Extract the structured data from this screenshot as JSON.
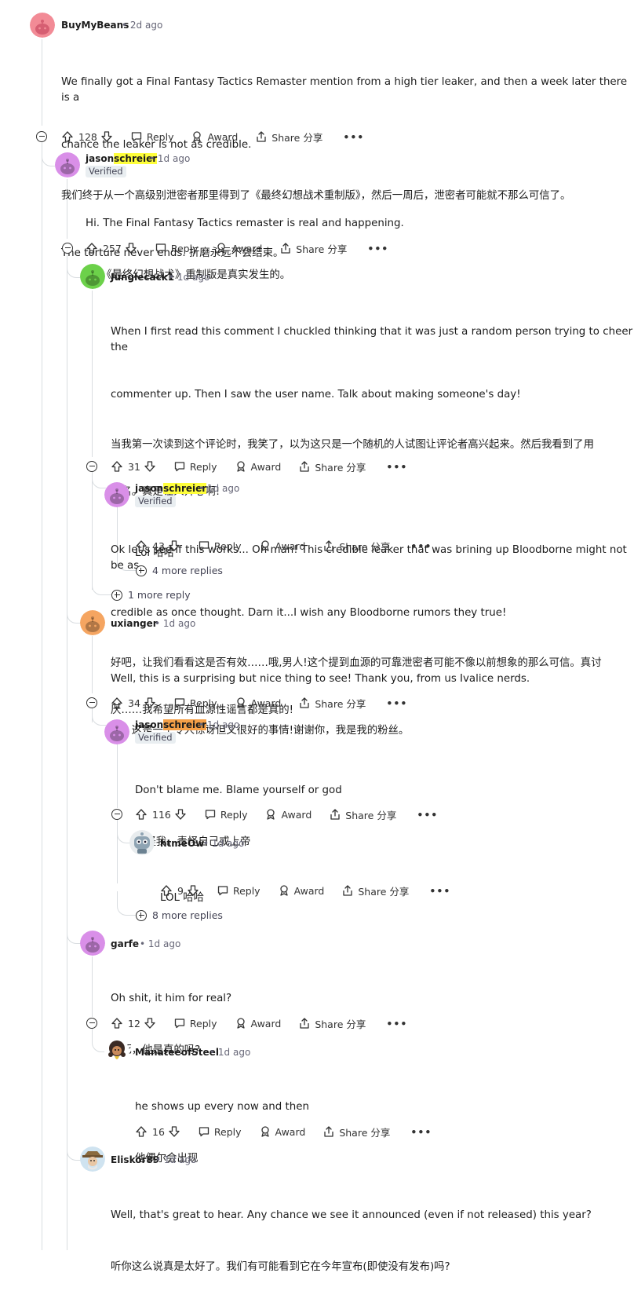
{
  "comments": [
    {
      "id": "c1",
      "user": "BuyMyBeans",
      "time": "2d ago",
      "verified": false,
      "lines": [
        "We finally got a Final Fantasy Tactics Remaster mention from a high tier leaker, and then a week later there is a",
        "chance the leaker is not as credible.",
        "我们终于从一个高级别泄密者那里得到了《最终幻想战术重制版》，然后一周后，泄密者可能就不那么可信了。",
        "",
        "The torture never ends. 折磨永远不会结束。"
      ],
      "score": "128",
      "avatar_color": "#f28b96"
    },
    {
      "id": "c2",
      "user": "jasonschreier",
      "user_a": "jason",
      "user_b": "schreier",
      "time": "1d ago",
      "verified": true,
      "lines": [
        "Hi. The Final Fantasy Tactics remaster is real and happening.",
        "嗨。《最终幻想战术》重制版是真实发生的。"
      ],
      "score": "257",
      "avatar_color": "#d98fe8"
    },
    {
      "id": "c3",
      "user": "Junglecack1",
      "time": "1d ago",
      "verified": false,
      "lines": [
        "When I first read this comment I chuckled thinking that it was just a random person trying to cheer the",
        "commenter up. Then I saw the user name. Talk about making someone's day!",
        "当我第一次读到这个评论时，我笑了，以为这只是一个随机的人试图让评论者高兴起来。然后我看到了用",
        "户名。真是让人开心啊!",
        "",
        "Ok let's see if this works... Oh man! This credible leaker that was brining up Bloodborne might not be as",
        "credible as once thought. Darn it...I wish any Bloodborne rumors they true!",
        "好吧，让我们看看这是否有效……哦,男人!这个提到血源的可靠泄密者可能不像以前想象的那么可信。真讨",
        "厌……我希望所有血源性谣言都是真的!"
      ],
      "score": "31",
      "avatar_color": "#6cd14a"
    },
    {
      "id": "c4",
      "user": "jasonschreier",
      "user_a": "jason",
      "user_b": "schreier",
      "time": "1d ago",
      "verified": true,
      "lines": [
        "Lol 哈哈"
      ],
      "score": "43",
      "avatar_color": "#d98fe8"
    },
    {
      "id": "c5",
      "user": "uxianger",
      "time": "1d ago",
      "verified": false,
      "lines": [
        "Well, this is a surprising but nice thing to see! Thank you, from us Ivalice nerds.",
        "嗯，这是一个令人惊讶但又很好的事情!谢谢你，我是我的粉丝。"
      ],
      "score": "34",
      "avatar_color": "#f5a561"
    },
    {
      "id": "c6",
      "user": "jasonschreier",
      "user_a": "jason",
      "user_b": "schreier",
      "time": "1d ago",
      "verified": true,
      "lines": [
        "Don't blame me. Blame yourself or god",
        "别怪我。责怪自己或上帝"
      ],
      "score": "116",
      "avatar_color": "#d98fe8"
    },
    {
      "id": "c7",
      "user": "htmeOw",
      "time": "1d ago",
      "verified": false,
      "lines": [
        "LOL 哈哈"
      ],
      "score": "9",
      "avatar_color": "#e8ecee"
    },
    {
      "id": "c8",
      "user": "garfe",
      "time": "1d ago",
      "verified": false,
      "lines": [
        "Oh shit, it him for real?",
        "该死，他是真的吗?"
      ],
      "score": "12",
      "avatar_color": "#d98fe8"
    },
    {
      "id": "c9",
      "user": "ManateeofSteel",
      "time": "1d ago",
      "verified": false,
      "lines": [
        "he shows up every now and then",
        "他偶尔会出现"
      ],
      "score": "16",
      "avatar_color": "#ffffff"
    },
    {
      "id": "c10",
      "user": "Eliskor89",
      "time": "1d ago",
      "verified": false,
      "lines": [
        "Well, that's great to hear. Any chance we see it announced (even if not released) this year?",
        "听你这么说真是太好了。我们有可能看到它在今年宣布(即使没有发布)吗?"
      ],
      "avatar_color": "#cfe3f0"
    }
  ],
  "labels": {
    "reply": "Reply",
    "award": "Award",
    "share": "Share 分享",
    "verified": "Verified",
    "more": "•••",
    "sep": "•"
  },
  "more_replies": {
    "m1": "4 more replies",
    "m2": "1 more reply",
    "m3": "8 more replies"
  },
  "highlight_colors": {
    "yellow": "#ffff3b",
    "orange": "#f6a047"
  }
}
